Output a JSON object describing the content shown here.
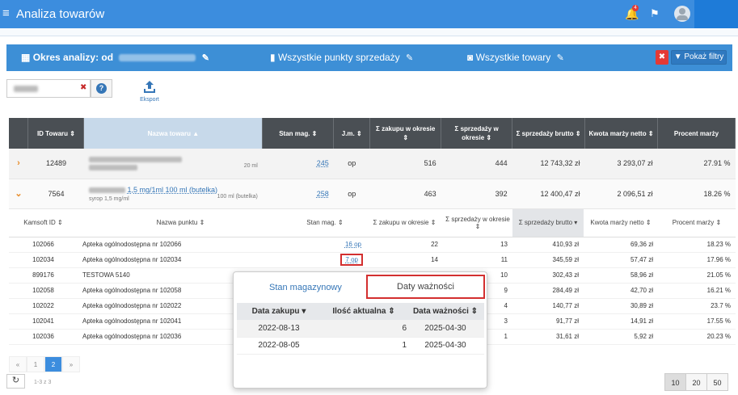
{
  "app": {
    "title": "Analiza towarów",
    "notif_count": "4"
  },
  "filters": {
    "period_label": "Okres analizy: od",
    "points_label": "Wszystkie punkty sprzedaży",
    "products_label": "Wszystkie towary",
    "show_filters": "Pokaż filtry"
  },
  "toolbar": {
    "export_label": "Eksport"
  },
  "grid": {
    "headers": [
      "ID Towaru",
      "Nazwa towaru",
      "Stan mag.",
      "J.m.",
      "Σ zakupu w okresie",
      "Σ sprzedaży w okresie",
      "Σ sprzedaży brutto",
      "Kwota marży netto",
      "Procent marży"
    ],
    "rows": [
      {
        "id": "12489",
        "qty_suffix": "20 ml",
        "stock": "245",
        "unit": "op",
        "purchase": "516",
        "sales": "444",
        "gross": "12 743,32 zł",
        "margin": "3 293,07 zł",
        "percent": "27.91 %"
      },
      {
        "id": "7564",
        "name": "1,5 mg/1ml 100 ml (butelka)",
        "sub": "syrop 1,5 mg/ml",
        "qty_suffix": "100 ml (butelka)",
        "stock": "258",
        "unit": "op",
        "purchase": "463",
        "sales": "392",
        "gross": "12 400,47 zł",
        "margin": "2 096,51 zł",
        "percent": "18.26 %"
      }
    ]
  },
  "subgrid": {
    "headers": [
      "Kamsoft ID",
      "Nazwa punktu",
      "Stan mag.",
      "Σ zakupu w okresie",
      "Σ sprzedaży w okresie",
      "Σ sprzedaży brutto",
      "Kwota marży netto",
      "Procent marży"
    ],
    "rows": [
      {
        "id": "102066",
        "name": "Apteka ogólnodostępna nr 102066",
        "stock": "16 op",
        "purchase": "22",
        "sales": "13",
        "gross": "410,93 zł",
        "margin": "69,36 zł",
        "percent": "18.23 %"
      },
      {
        "id": "102034",
        "name": "Apteka ogólnodostępna nr 102034",
        "stock": "7 op",
        "purchase": "14",
        "sales": "11",
        "gross": "345,59 zł",
        "margin": "57,47 zł",
        "percent": "17.96 %"
      },
      {
        "id": "899176",
        "name": "TESTOWA 5140",
        "stock": "",
        "purchase": "",
        "sales": "10",
        "gross": "302,43 zł",
        "margin": "58,96 zł",
        "percent": "21.05 %"
      },
      {
        "id": "102058",
        "name": "Apteka ogólnodostępna nr 102058",
        "stock": "",
        "purchase": "",
        "sales": "9",
        "gross": "284,49 zł",
        "margin": "42,70 zł",
        "percent": "16.21 %"
      },
      {
        "id": "102022",
        "name": "Apteka ogólnodostępna nr 102022",
        "stock": "",
        "purchase": "",
        "sales": "4",
        "gross": "140,77 zł",
        "margin": "30,89 zł",
        "percent": "23.7 %"
      },
      {
        "id": "102041",
        "name": "Apteka ogólnodostępna nr 102041",
        "stock": "",
        "purchase": "",
        "sales": "3",
        "gross": "91,77 zł",
        "margin": "14,91 zł",
        "percent": "17.55 %"
      },
      {
        "id": "102036",
        "name": "Apteka ogólnodostępna nr 102036",
        "stock": "",
        "purchase": "",
        "sales": "1",
        "gross": "31,61 zł",
        "margin": "5,92 zł",
        "percent": "20.23 %"
      }
    ]
  },
  "pager": {
    "pages": [
      "«",
      "1",
      "2",
      "»"
    ],
    "count_label": "1-3 z 3",
    "sizes": [
      "10",
      "20",
      "50"
    ]
  },
  "popup": {
    "tab_stock": "Stan magazynowy",
    "tab_expiry": "Daty ważności",
    "headers": [
      "Data zakupu",
      "Ilość aktualna",
      "Data ważności"
    ],
    "rows": [
      {
        "date": "2022-08-13",
        "qty": "6",
        "expiry": "2025-04-30"
      },
      {
        "date": "2022-08-05",
        "qty": "1",
        "expiry": "2025-04-30"
      }
    ]
  }
}
